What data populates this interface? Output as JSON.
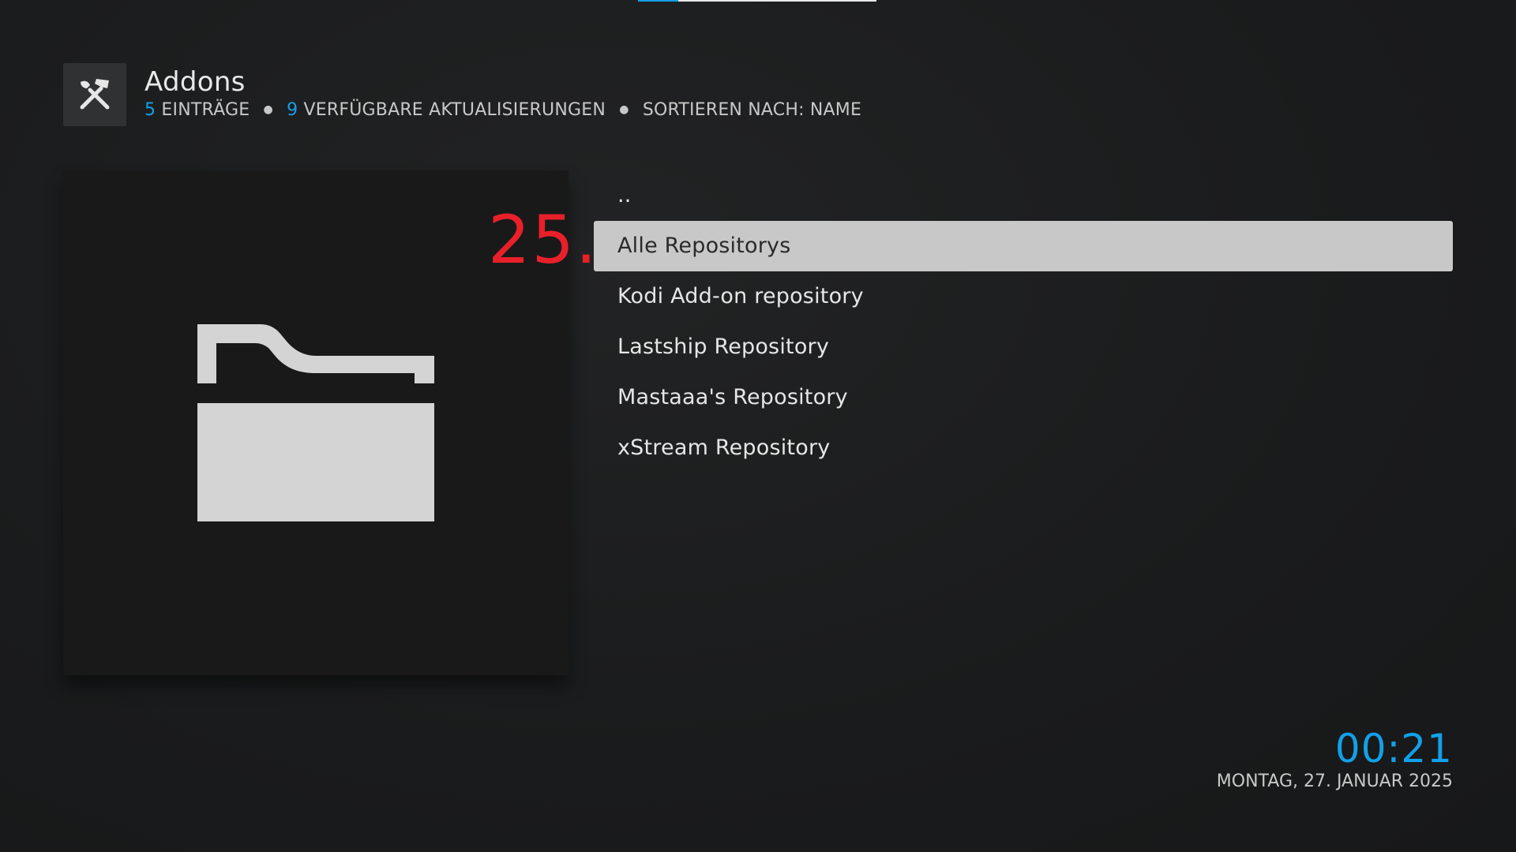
{
  "header": {
    "title": "Addons",
    "icon": "tools-icon",
    "entries_count": "5",
    "entries_label": "EINTRÄGE",
    "updates_count": "9",
    "updates_label": "VERFÜGBARE AKTUALISIERUNGEN",
    "sort_label": "SORTIEREN NACH: NAME"
  },
  "thumbnail": {
    "icon": "folder-icon"
  },
  "annotation": {
    "text": "25."
  },
  "list": {
    "items": [
      {
        "label": ".."
      },
      {
        "label": "Alle Repositorys"
      },
      {
        "label": "Kodi Add-on repository"
      },
      {
        "label": "Lastship Repository"
      },
      {
        "label": "Mastaaa's Repository"
      },
      {
        "label": "xStream Repository"
      }
    ],
    "focused_index": 1
  },
  "footer": {
    "time": "00:21",
    "date": "MONTAG, 27. JANUAR 2025"
  },
  "colors": {
    "accent": "#12a0e8",
    "focus_bg": "#c8c8c8",
    "annotation": "#e8202a"
  },
  "progress": {
    "fraction": 0.17
  }
}
